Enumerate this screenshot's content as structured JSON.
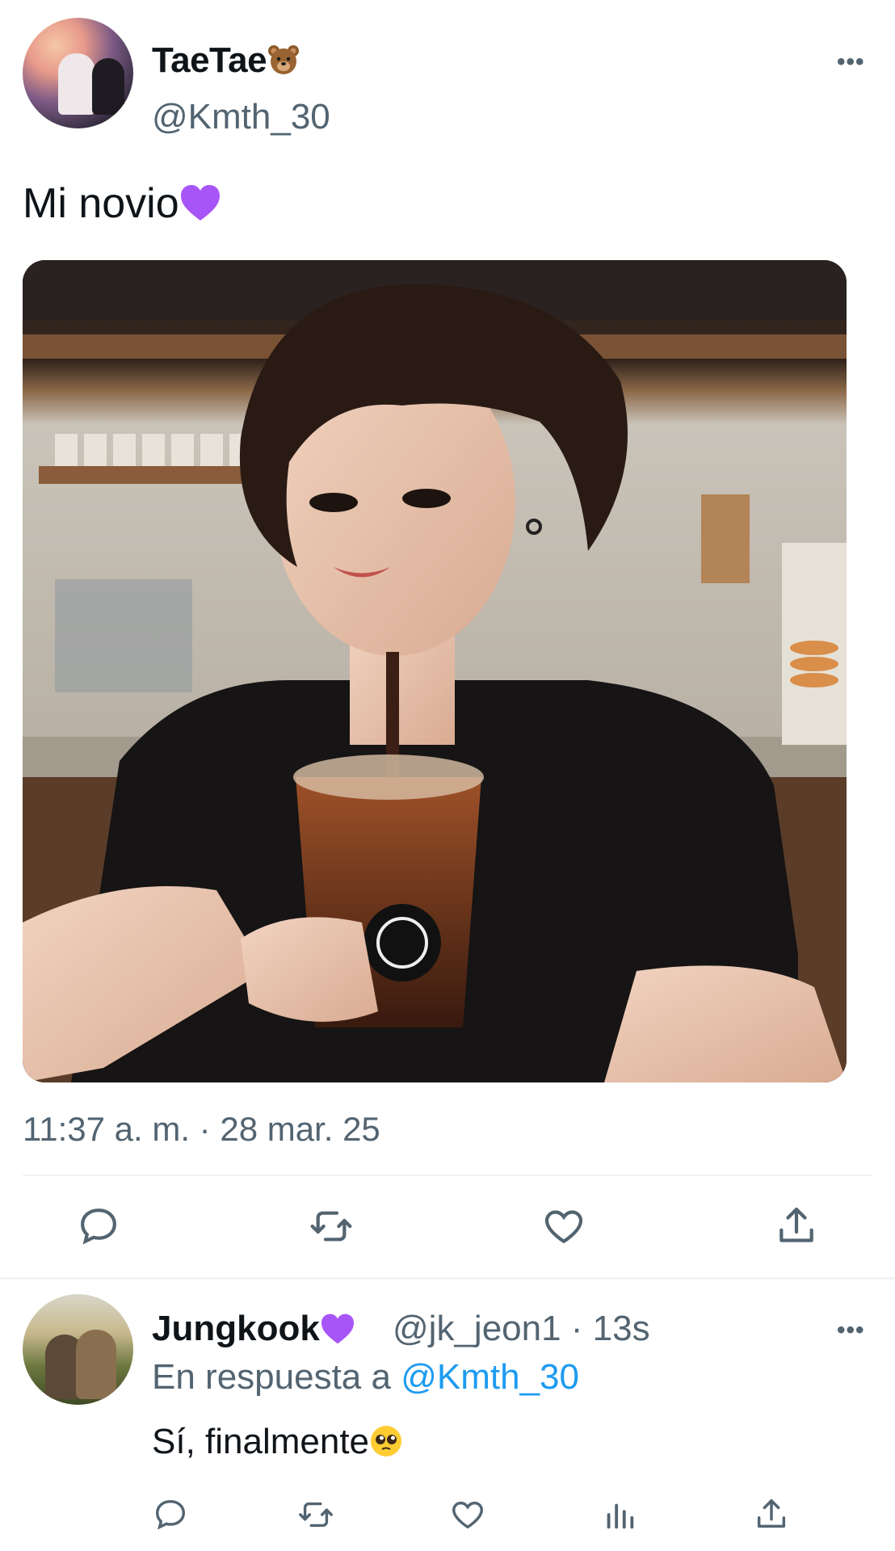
{
  "tweet": {
    "display_name": "TaeTae",
    "name_emoji": "bear-face-emoji",
    "handle": "@Kmth_30",
    "more_label": "•••",
    "text": "Mi novio",
    "text_emoji": "purple-heart-emoji",
    "timestamp": "11:37 a. m. · 28 mar. 25",
    "media_description_icon": "photo",
    "actions": [
      "reply-icon",
      "retweet-icon",
      "like-icon",
      "share-icon"
    ]
  },
  "reply": {
    "display_name": "Jungkook",
    "name_emoji": "purple-heart-emoji",
    "meta": "@jk_jeon1 · 13s",
    "more_label": "•••",
    "replying_prefix": "En respuesta a",
    "replying_mention": "@Kmth_30",
    "text": "Sí, finalmente",
    "text_emoji": "pleading-face-emoji",
    "actions": [
      "reply-icon",
      "retweet-icon",
      "like-icon",
      "views-icon",
      "share-icon"
    ]
  },
  "colors": {
    "text_primary": "#0f1419",
    "text_secondary": "#536471",
    "link": "#1d9bf0",
    "divider": "#eff3f4",
    "heart": "#a855f7"
  }
}
